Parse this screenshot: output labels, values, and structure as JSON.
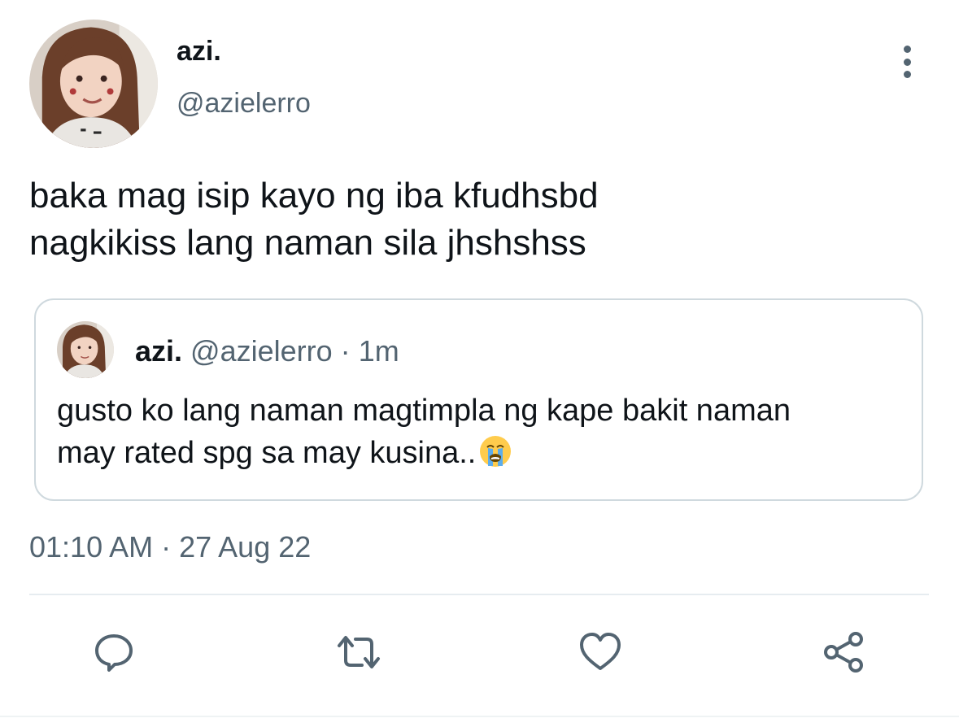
{
  "author": {
    "display_name": "azi.",
    "handle": "@azielerro",
    "avatar_icon": "profile-photo"
  },
  "tweet": {
    "text_line1": "baka mag isip kayo ng iba kfudhsbd",
    "text_line2": "nagkikiss lang naman sila jhshshss",
    "timestamp": "01:10 AM · 27 Aug 22"
  },
  "quoted_tweet": {
    "display_name": "azi.",
    "handle": "@azielerro",
    "separator": "·",
    "age": "1m",
    "text_line1": "gusto ko lang naman magtimpla ng kape bakit naman",
    "text_line2": "may rated spg sa may kusina..",
    "emoji": "loudly-crying-face"
  },
  "actions": {
    "icons": [
      "reply-icon",
      "retweet-icon",
      "like-icon",
      "share-icon"
    ]
  },
  "colors": {
    "text_primary": "#0f1419",
    "text_secondary": "#536471",
    "border": "#cfd9de"
  }
}
